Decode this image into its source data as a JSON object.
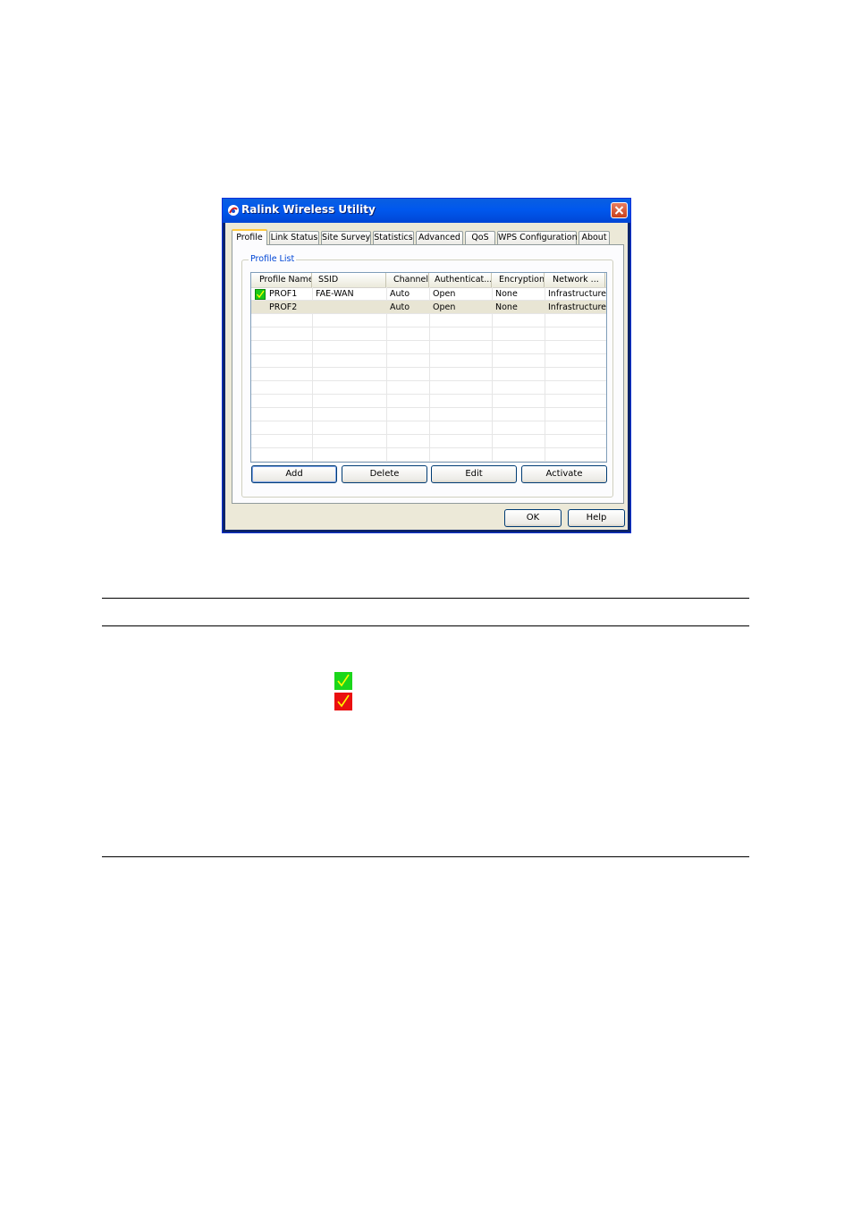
{
  "window": {
    "title": "Ralink Wireless Utility",
    "tabs": [
      "Profile",
      "Link Status",
      "Site Survey",
      "Statistics",
      "Advanced",
      "QoS",
      "WPS Configuration",
      "About"
    ],
    "active_tab": "Profile"
  },
  "profile_list": {
    "group_label": "Profile List",
    "columns": [
      "Profile Name",
      "SSID",
      "Channel",
      "Authenticat...",
      "Encryption",
      "Network ..."
    ],
    "rows": [
      {
        "profile": "PROF1",
        "ssid": "FAE-WAN",
        "channel": "Auto",
        "auth": "Open",
        "encryption": "None",
        "network": "Infrastructure",
        "active": true
      },
      {
        "profile": "PROF2",
        "ssid": "",
        "channel": "Auto",
        "auth": "Open",
        "encryption": "None",
        "network": "Infrastructure",
        "active": false
      }
    ]
  },
  "buttons": {
    "add": "Add",
    "delete": "Delete",
    "edit": "Edit",
    "activate": "Activate",
    "ok": "OK",
    "help": "Help"
  },
  "colors": {
    "check_green": "#1bd61b",
    "check_red": "#ea1010",
    "check_mark": "#ffff00"
  }
}
